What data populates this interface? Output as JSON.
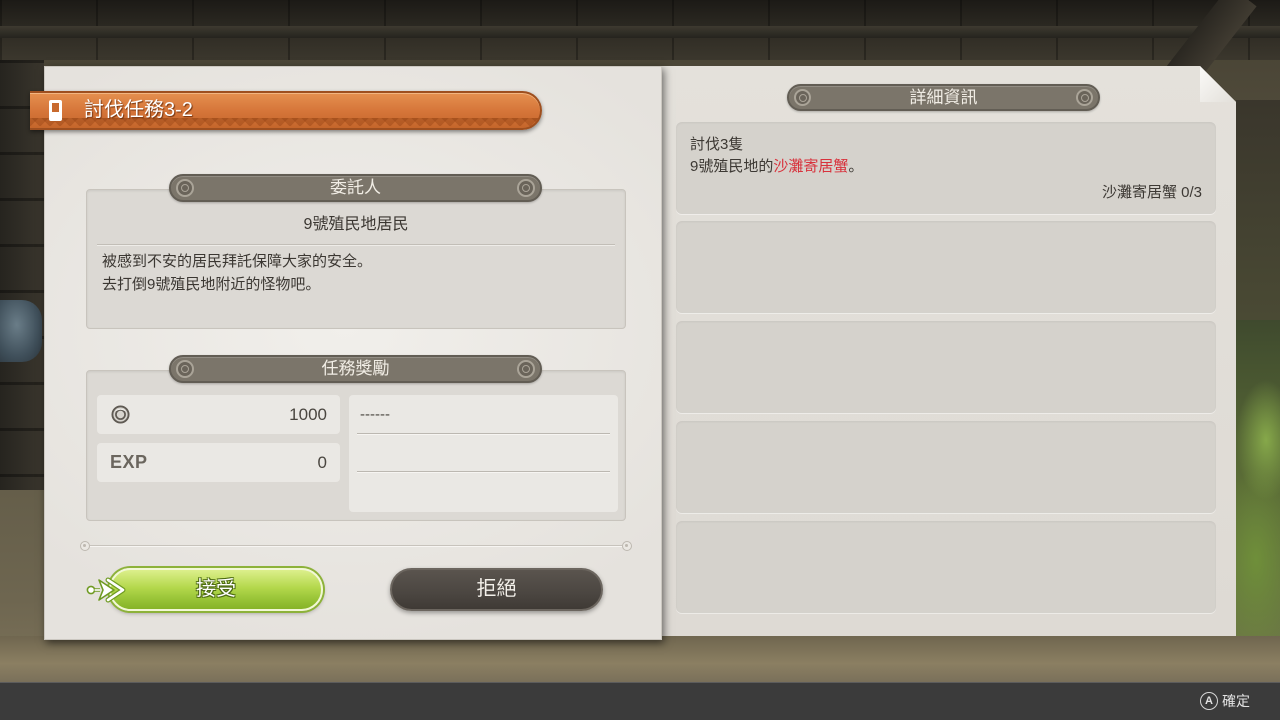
{
  "colors": {
    "banner_orange": "#d6763a",
    "highlight_red": "#d8323c",
    "accept_green": "#9cc73a",
    "reject_dark": "#4b4641",
    "pill_taupe": "#7b756a"
  },
  "quest": {
    "icon": "quest-icon",
    "title": "討伐任務3-2"
  },
  "client": {
    "header": "委託人",
    "name": "9號殖民地居民",
    "description": [
      "被感到不安的居民拜託保障大家的安全。",
      "去打倒9號殖民地附近的怪物吧。"
    ]
  },
  "rewards": {
    "header": "任務獎勵",
    "credits_icon": "credits-coin-icon",
    "credits": "1000",
    "exp_label": "EXP",
    "exp": "0",
    "items": [
      "------",
      "",
      ""
    ]
  },
  "actions": {
    "accept": "接受",
    "reject": "拒絕"
  },
  "details": {
    "header": "詳細資訊",
    "objectives": [
      {
        "title": "討伐3隻",
        "text_before": "9號殖民地的",
        "target": "沙灘寄居蟹",
        "text_after": "。",
        "progress_target": "沙灘寄居蟹",
        "progress": "0/3"
      }
    ]
  },
  "footer": {
    "button_glyph": "A",
    "label": "確定"
  }
}
